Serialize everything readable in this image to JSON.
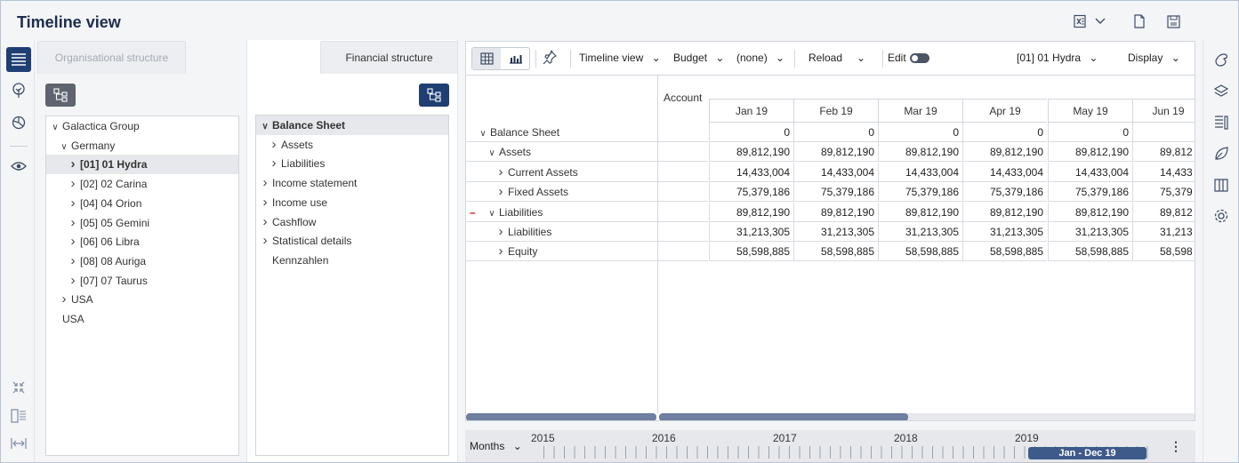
{
  "header": {
    "title": "Timeline view"
  },
  "org_panel": {
    "tab_label": "Organisational structure",
    "tree": [
      {
        "label": "Galactica Group",
        "level": 0,
        "chevron": "down",
        "selected": false
      },
      {
        "label": "Germany",
        "level": 1,
        "chevron": "down",
        "selected": false
      },
      {
        "label": "[01] 01 Hydra",
        "level": 2,
        "chevron": "right",
        "selected": true
      },
      {
        "label": "[02] 02 Carina",
        "level": 2,
        "chevron": "right",
        "selected": false
      },
      {
        "label": "[04] 04 Orion",
        "level": 2,
        "chevron": "right",
        "selected": false
      },
      {
        "label": "[05] 05 Gemini",
        "level": 2,
        "chevron": "right",
        "selected": false
      },
      {
        "label": "[06] 06 Libra",
        "level": 2,
        "chevron": "right",
        "selected": false
      },
      {
        "label": "[08] 08 Auriga",
        "level": 2,
        "chevron": "right",
        "selected": false
      },
      {
        "label": "[07] 07 Taurus",
        "level": 2,
        "chevron": "right",
        "selected": false
      },
      {
        "label": "USA",
        "level": 1,
        "chevron": "right",
        "selected": false
      },
      {
        "label": "USA",
        "level": 0,
        "chevron": "none",
        "selected": false
      }
    ]
  },
  "fin_panel": {
    "tab_label": "Financial structure",
    "tree": [
      {
        "label": "Balance Sheet",
        "level": 0,
        "chevron": "down",
        "selected": true
      },
      {
        "label": "Assets",
        "level": 1,
        "chevron": "right",
        "selected": false
      },
      {
        "label": "Liabilities",
        "level": 1,
        "chevron": "right",
        "selected": false
      },
      {
        "label": "Income statement",
        "level": 0,
        "chevron": "right",
        "selected": false
      },
      {
        "label": "Income use",
        "level": 0,
        "chevron": "right",
        "selected": false
      },
      {
        "label": "Cashflow",
        "level": 0,
        "chevron": "right",
        "selected": false
      },
      {
        "label": "Statistical details",
        "level": 0,
        "chevron": "right",
        "selected": false
      },
      {
        "label": "Kennzahlen",
        "level": 0,
        "chevron": "none",
        "selected": false
      }
    ]
  },
  "toolbar": {
    "view_dropdown": "Timeline view",
    "scenario_dropdown": "Budget",
    "compare_dropdown": "(none)",
    "reload_label": "Reload",
    "edit_label": "Edit",
    "entity_dropdown": "[01] 01 Hydra",
    "display_dropdown": "Display"
  },
  "grid": {
    "account_header": "Account",
    "months": [
      "Jan 19",
      "Feb 19",
      "Mar 19",
      "Apr 19",
      "May 19",
      "Jun 19"
    ],
    "rows": [
      {
        "label": "Balance Sheet",
        "level": 0,
        "chevron": "down",
        "marker": "",
        "values": [
          "0",
          "0",
          "0",
          "0",
          "0",
          ""
        ]
      },
      {
        "label": "Assets",
        "level": 1,
        "chevron": "down",
        "marker": "",
        "values": [
          "89,812,190",
          "89,812,190",
          "89,812,190",
          "89,812,190",
          "89,812,190",
          "89,812"
        ]
      },
      {
        "label": "Current Assets",
        "level": 2,
        "chevron": "right",
        "marker": "",
        "values": [
          "14,433,004",
          "14,433,004",
          "14,433,004",
          "14,433,004",
          "14,433,004",
          "14,433"
        ]
      },
      {
        "label": "Fixed Assets",
        "level": 2,
        "chevron": "right",
        "marker": "",
        "values": [
          "75,379,186",
          "75,379,186",
          "75,379,186",
          "75,379,186",
          "75,379,186",
          "75,379"
        ]
      },
      {
        "label": "Liabilities",
        "level": 1,
        "chevron": "down",
        "marker": "–",
        "values": [
          "89,812,190",
          "89,812,190",
          "89,812,190",
          "89,812,190",
          "89,812,190",
          "89,812"
        ]
      },
      {
        "label": "Liabilities",
        "level": 2,
        "chevron": "right",
        "marker": "",
        "values": [
          "31,213,305",
          "31,213,305",
          "31,213,305",
          "31,213,305",
          "31,213,305",
          "31,213"
        ]
      },
      {
        "label": "Equity",
        "level": 2,
        "chevron": "right",
        "marker": "",
        "values": [
          "58,598,885",
          "58,598,885",
          "58,598,885",
          "58,598,885",
          "58,598,885",
          "58,598"
        ]
      }
    ]
  },
  "timeline": {
    "mode_label": "Months",
    "years": [
      "2015",
      "2016",
      "2017",
      "2018",
      "2019"
    ],
    "range_label": "Jan - Dec 19"
  },
  "icons": {
    "excel": "excel-export-icon",
    "new_doc": "new-document-icon",
    "save": "save-icon"
  },
  "colors": {
    "accent": "#1f3f73",
    "scroll": "#6e7f9f",
    "range": "#3e5a8a",
    "negative_marker": "#d0021b"
  }
}
